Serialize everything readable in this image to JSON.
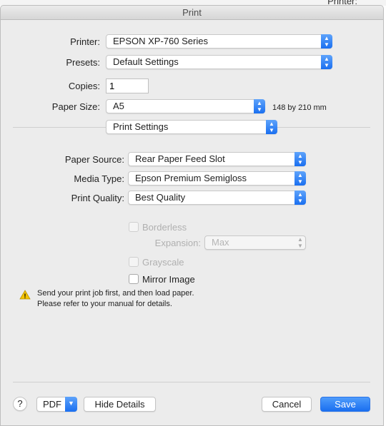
{
  "window": {
    "title": "Print"
  },
  "background": {
    "text": "Printer:"
  },
  "printer": {
    "label": "Printer:",
    "value": "EPSON XP-760 Series"
  },
  "presets": {
    "label": "Presets:",
    "value": "Default Settings"
  },
  "copies": {
    "label": "Copies:",
    "value": "1"
  },
  "paper_size": {
    "label": "Paper Size:",
    "value": "A5",
    "dimensions": "148 by 210 mm"
  },
  "panel": {
    "value": "Print Settings"
  },
  "paper_source": {
    "label": "Paper Source:",
    "value": "Rear Paper Feed Slot"
  },
  "media_type": {
    "label": "Media Type:",
    "value": "Epson Premium Semigloss"
  },
  "print_quality": {
    "label": "Print Quality:",
    "value": "Best Quality"
  },
  "borderless": {
    "label": "Borderless",
    "checked": false,
    "enabled": false
  },
  "expansion": {
    "label": "Expansion:",
    "value": "Max",
    "enabled": false
  },
  "grayscale": {
    "label": "Grayscale",
    "checked": false,
    "enabled": false
  },
  "mirror": {
    "label": "Mirror Image",
    "checked": false
  },
  "warning": {
    "icon": "warning-triangle-icon",
    "line1": "Send your print job first, and then load paper.",
    "line2": "Please refer to your manual for details."
  },
  "footer": {
    "help": "?",
    "pdf": "PDF",
    "hide_details": "Hide Details",
    "cancel": "Cancel",
    "save": "Save"
  },
  "colors": {
    "accent": "#1a73f0"
  }
}
